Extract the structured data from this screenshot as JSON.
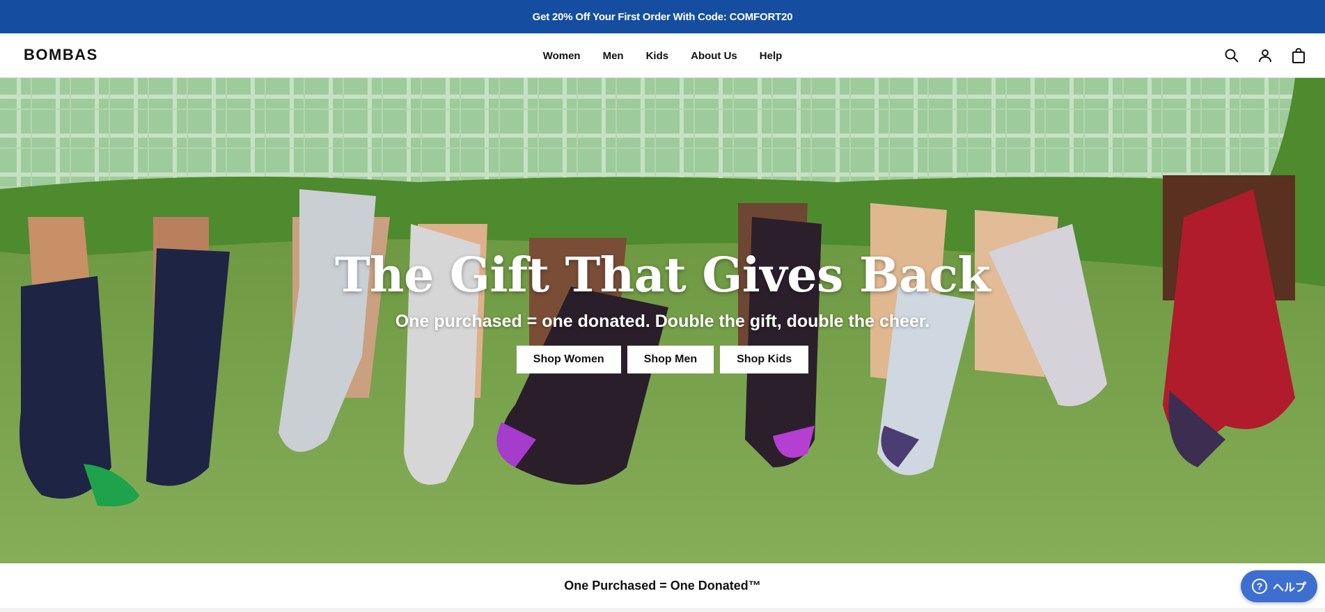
{
  "promo": {
    "text": "Get 20% Off Your First Order With Code: COMFORT20"
  },
  "header": {
    "logo": "BOMBAS",
    "nav": [
      "Women",
      "Men",
      "Kids",
      "About Us",
      "Help"
    ],
    "icons": [
      "search-icon",
      "account-icon",
      "bag-icon"
    ]
  },
  "hero": {
    "title": "The Gift That Gives Back",
    "subtitle": "One purchased = one donated. Double the gift, double the cheer.",
    "buttons": [
      "Shop Women",
      "Shop Men",
      "Shop Kids"
    ]
  },
  "mission": {
    "text": "One Purchased = One Donated™"
  },
  "help_widget": {
    "label": "ヘルプ",
    "icon": "question-icon"
  },
  "colors": {
    "promo_bg": "#154ea0",
    "help_bg": "#3d6fd0",
    "floor_green": "#77a04c",
    "blanket_green": "#9cc79a"
  }
}
